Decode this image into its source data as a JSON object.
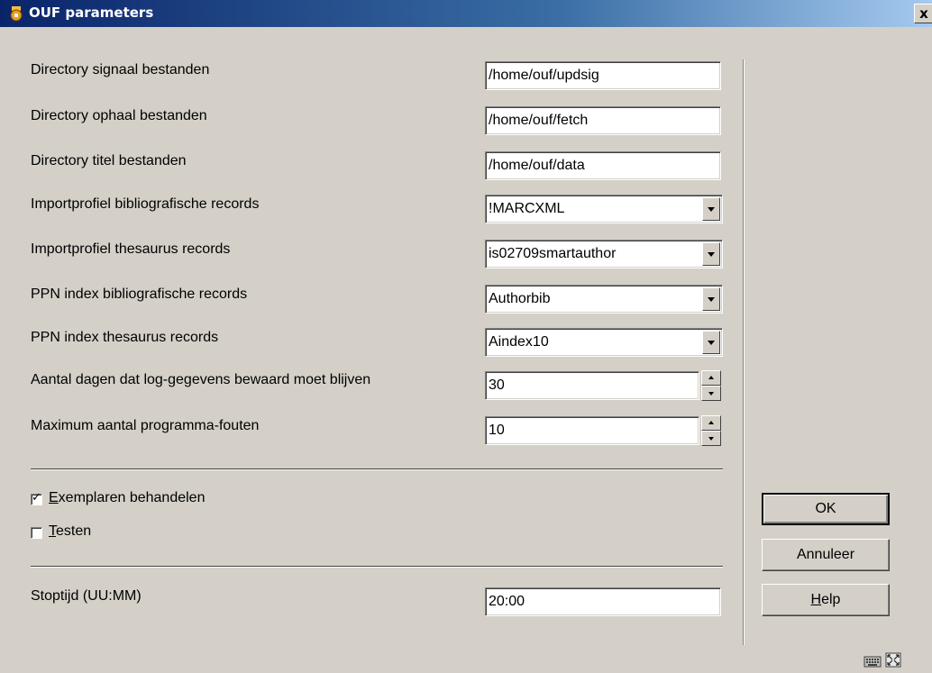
{
  "window": {
    "title": "OUF parameters",
    "close_label": "x"
  },
  "fields": [
    {
      "label": "Directory signaal bestanden",
      "value": "/home/ouf/updsig",
      "type": "text"
    },
    {
      "label": "Directory ophaal bestanden",
      "value": "/home/ouf/fetch",
      "type": "text"
    },
    {
      "label": "Directory titel bestanden",
      "value": "/home/ouf/data",
      "type": "text"
    },
    {
      "label": "Importprofiel bibliografische records",
      "value": "!MARCXML",
      "type": "select"
    },
    {
      "label": "Importprofiel thesaurus records",
      "value": "is02709smartauthor",
      "type": "select"
    },
    {
      "label": "PPN index bibliografische records",
      "value": "Authorbib",
      "type": "select"
    },
    {
      "label": "PPN index thesaurus records",
      "value": "Aindex10",
      "type": "select"
    },
    {
      "label": "Aantal dagen dat log-gegevens bewaard moet blijven",
      "value": "30",
      "type": "spinner"
    },
    {
      "label": "Maximum aantal programma-fouten",
      "value": "10",
      "type": "spinner"
    }
  ],
  "checkboxes": [
    {
      "label_mnemonic": "E",
      "label_rest": "xemplaren behandelen",
      "checked": true
    },
    {
      "label_mnemonic": "T",
      "label_rest": "esten",
      "checked": false
    }
  ],
  "stoptijd": {
    "label": "Stoptijd (UU:MM)",
    "value": "20:00"
  },
  "buttons": {
    "ok": "OK",
    "cancel": "Annuleer",
    "help_mnemonic": "H",
    "help_rest": "elp"
  },
  "icons": {
    "title": "app-icon",
    "status": [
      "keyboard-icon",
      "resize-icon"
    ]
  },
  "colors": {
    "titlebar_start": "#0a246a",
    "titlebar_end": "#a6caf0",
    "dialog_bg": "#d4d0c8"
  }
}
